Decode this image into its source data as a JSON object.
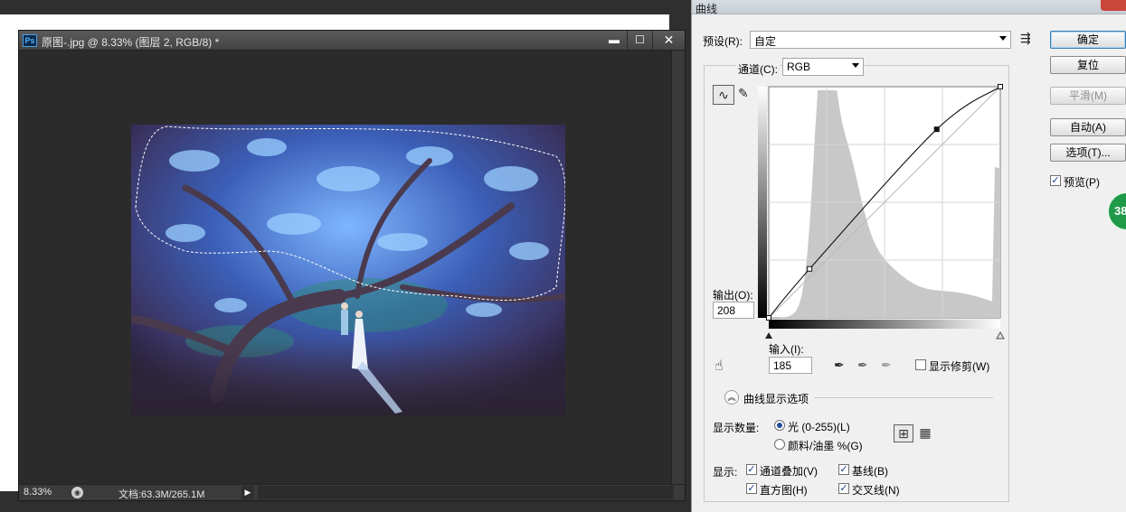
{
  "document": {
    "app_icon": "Ps",
    "title": "原图-.jpg @ 8.33% (图层 2, RGB/8) *",
    "minimize_icon": "minimize-icon",
    "maximize_icon": "maximize-icon",
    "close_icon": "close-icon",
    "status": {
      "zoom": "8.33%",
      "doc_info": "文档:63.3M/265.1M"
    }
  },
  "curves_dialog": {
    "title": "曲线",
    "preset_label": "预设(R):",
    "preset_value": "自定",
    "channel_label": "通道(C):",
    "channel_value": "RGB",
    "output_label": "输出(O):",
    "output_value": "208",
    "input_label": "输入(I):",
    "input_value": "185",
    "show_clipping_label": "显示修剪(W)",
    "display_options_label": "曲线显示选项",
    "show_amount_label": "显示数量:",
    "light_option": "光 (0-255)(L)",
    "pigment_option": "颜料/油墨 %(G)",
    "show_label": "显示:",
    "channel_overlays": "通道叠加(V)",
    "baseline": "基线(B)",
    "histogram": "直方图(H)",
    "intersection": "交叉线(N)",
    "buttons": {
      "ok": "确定",
      "reset": "复位",
      "smooth": "平滑(M)",
      "auto": "自动(A)",
      "options": "选项(T)..."
    },
    "preview_label": "预览(P)",
    "light_selected": true,
    "checks": {
      "show_clipping": false,
      "channel_overlays": true,
      "baseline": true,
      "histogram": true,
      "intersection": true,
      "preview": true
    },
    "curve_points": [
      [
        0,
        0
      ],
      [
        45,
        54
      ],
      [
        185,
        208
      ],
      [
        255,
        255
      ]
    ]
  },
  "badge": {
    "text": "38"
  }
}
